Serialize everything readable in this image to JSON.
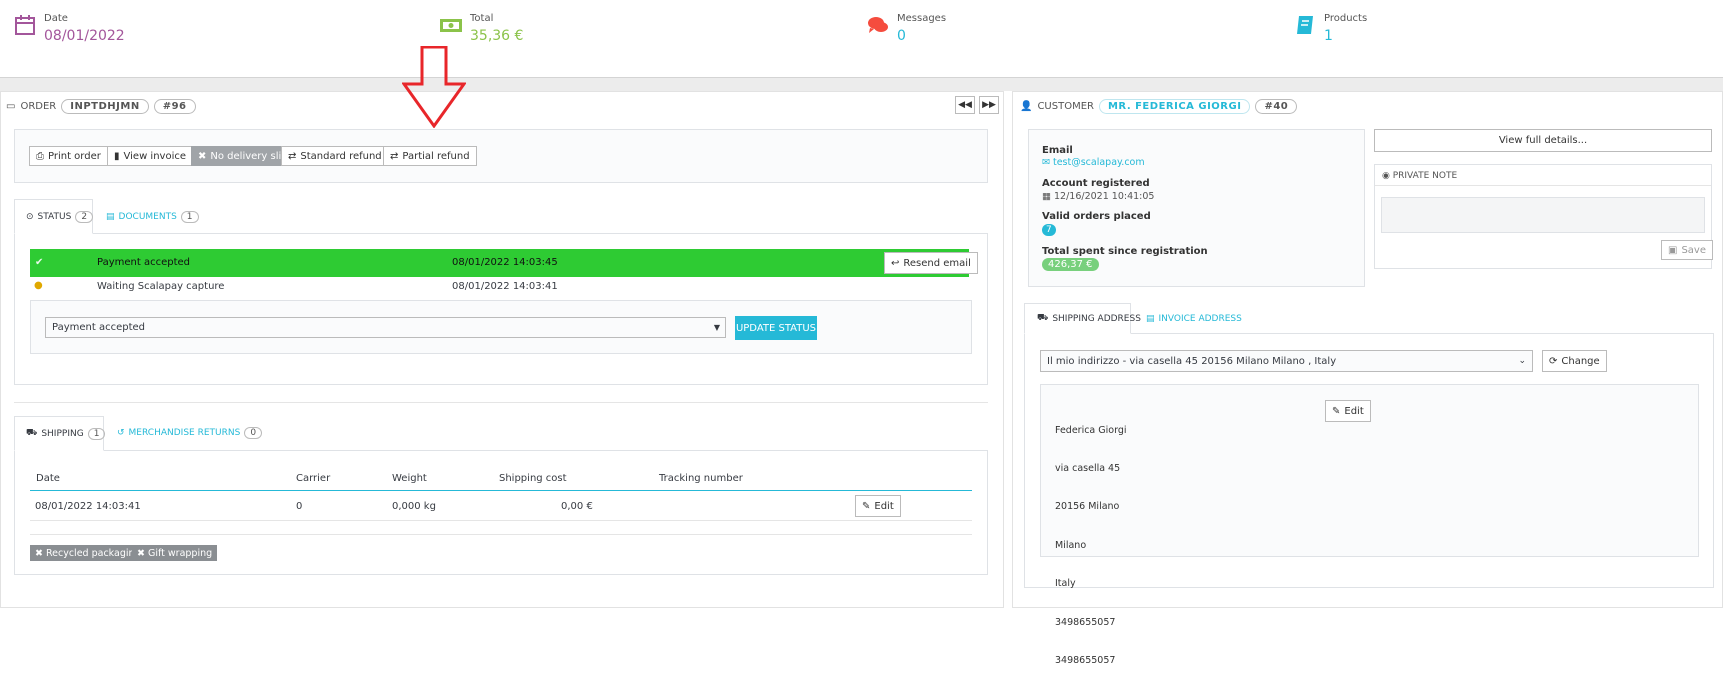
{
  "kpis": [
    {
      "label": "Date",
      "value": "08/01/2022",
      "icon": "calendar-icon",
      "color": "#a3569b"
    },
    {
      "label": "Total",
      "value": "35,36 €",
      "icon": "money-icon",
      "color": "#8bc34a"
    },
    {
      "label": "Messages",
      "value": "0",
      "icon": "comments-icon",
      "color": "#f54c3e"
    },
    {
      "label": "Products",
      "value": "1",
      "icon": "book-icon",
      "color": "#25b9d7"
    }
  ],
  "order": {
    "title": "ORDER",
    "reference": "INPTDHJMN",
    "id": "#96",
    "actions": {
      "print_order": "Print order",
      "view_invoice": "View invoice",
      "no_delivery_slip": "No delivery slip",
      "standard_refund": "Standard refund",
      "partial_refund": "Partial refund"
    },
    "tabs": {
      "status_label": "STATUS",
      "status_count": "2",
      "documents_label": "DOCUMENTS",
      "documents_count": "1"
    },
    "history": [
      {
        "state": "Payment accepted",
        "date": "08/01/2022 14:03:45",
        "action": "Resend email"
      },
      {
        "state": "Waiting Scalapay capture",
        "date": "08/01/2022 14:03:41"
      }
    ],
    "status_select": "Payment accepted",
    "update_status": "UPDATE STATUS",
    "shipping_tabs": {
      "shipping_label": "SHIPPING",
      "shipping_count": "1",
      "returns_label": "MERCHANDISE RETURNS",
      "returns_count": "0"
    },
    "shipping_table": {
      "headers": [
        "Date",
        "Carrier",
        "Weight",
        "Shipping cost",
        "Tracking number"
      ],
      "row": {
        "date": "08/01/2022 14:03:41",
        "carrier": "0",
        "weight": "0,000 kg",
        "cost": "0,00 €",
        "edit": "Edit"
      }
    },
    "tags": {
      "recycled": "Recycled packaging",
      "gift": "Gift wrapping"
    }
  },
  "customer": {
    "title": "CUSTOMER",
    "name": "MR. FEDERICA GIORGI",
    "id": "#40",
    "email_label": "Email",
    "email": "test@scalapay.com",
    "registered_label": "Account registered",
    "registered": "12/16/2021 10:41:05",
    "orders_label": "Valid orders placed",
    "orders": "7",
    "spent_label": "Total spent since registration",
    "spent": "426,37 €",
    "view_details": "View full details...",
    "private_note_title": "PRIVATE NOTE",
    "save": "Save"
  },
  "address": {
    "tab_shipping": "SHIPPING ADDRESS",
    "tab_invoice": "INVOICE ADDRESS",
    "select_value": "Il mio indirizzo - via casella 45 20156 Milano Milano , Italy",
    "change": "Change",
    "edit": "Edit",
    "lines": [
      "Federica Giorgi",
      "via casella 45",
      "20156 Milano",
      "Milano",
      "Italy",
      "3498655057",
      "3498655057"
    ]
  },
  "annotation": {
    "arrow_color": "#e8262a"
  }
}
